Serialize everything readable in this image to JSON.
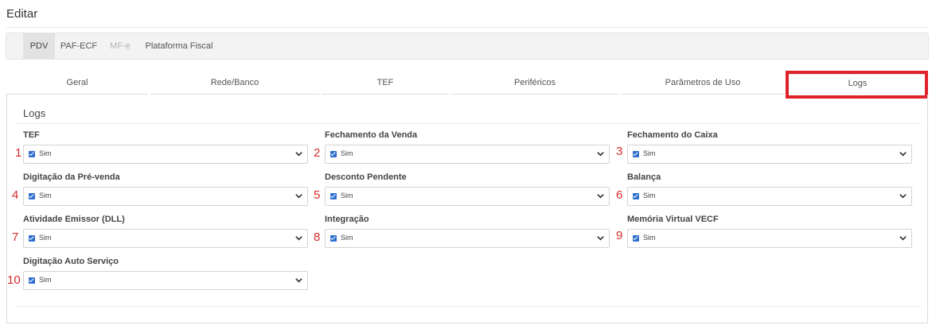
{
  "page": {
    "title": "Editar"
  },
  "top_tabs": [
    {
      "label": "PDV",
      "active": true,
      "disabled": false
    },
    {
      "label": "PAF-ECF",
      "active": false,
      "disabled": false
    },
    {
      "label": "MF-e",
      "active": false,
      "disabled": true
    },
    {
      "label": "Plataforma Fiscal",
      "active": false,
      "disabled": false
    }
  ],
  "sub_tabs": [
    {
      "label": "Geral",
      "active": false
    },
    {
      "label": "Rede/Banco",
      "active": false
    },
    {
      "label": "TEF",
      "active": false
    },
    {
      "label": "Periféricos",
      "active": false
    },
    {
      "label": "Parâmetros de Uso",
      "active": false
    },
    {
      "label": "Logs",
      "active": true
    }
  ],
  "panel": {
    "title": "Logs",
    "fields": [
      {
        "num": "1",
        "label": "TEF",
        "value": "Sim"
      },
      {
        "num": "2",
        "label": "Fechamento da Venda",
        "value": "Sim"
      },
      {
        "num": "3",
        "label": "Fechamento do Caixa",
        "value": "Sim"
      },
      {
        "num": "4",
        "label": "Digitação da Pré-venda",
        "value": "Sim"
      },
      {
        "num": "5",
        "label": "Desconto Pendente",
        "value": "Sim"
      },
      {
        "num": "6",
        "label": "Balança",
        "value": "Sim"
      },
      {
        "num": "7",
        "label": "Atividade Emissor (DLL)",
        "value": "Sim"
      },
      {
        "num": "8",
        "label": "Integração",
        "value": "Sim"
      },
      {
        "num": "9",
        "label": "Memória Virtual VECF",
        "value": "Sim"
      },
      {
        "num": "10",
        "label": "Digitação Auto Serviço",
        "value": "Sim"
      }
    ]
  },
  "colors": {
    "annotation": "#e0222a",
    "checkbox": "#2f6fcf"
  }
}
